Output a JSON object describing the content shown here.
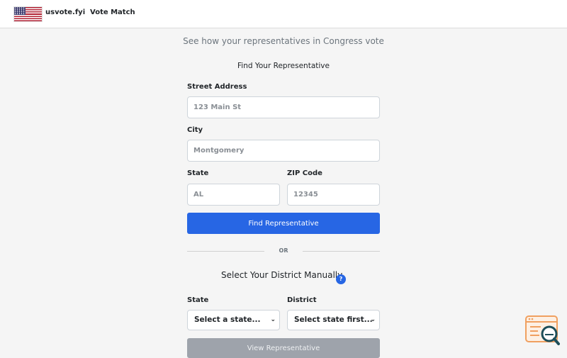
{
  "header": {
    "brand": "usvote.fyi",
    "nav_link": "Vote Match"
  },
  "subtitle": "See how your representatives in Congress vote",
  "address_form": {
    "title": "Find Your Representative",
    "street_label": "Street Address",
    "street_placeholder": "123 Main St",
    "city_label": "City",
    "city_placeholder": "Montgomery",
    "state_label": "State",
    "state_placeholder": "AL",
    "zip_label": "ZIP Code",
    "zip_placeholder": "12345",
    "submit_label": "Find Representative"
  },
  "divider_text": "OR",
  "manual_form": {
    "title": "Select Your District Manually",
    "help_icon_text": "?",
    "state_label": "State",
    "state_select_value": "Select a state...",
    "district_label": "District",
    "district_select_value": "Select state first...",
    "submit_label": "View Representative"
  },
  "colors": {
    "primary": "#2766e4",
    "disabled": "#9ea3ab",
    "widget": "#f0a060"
  },
  "icons": {
    "flag": "us-flag-icon",
    "help": "help-icon",
    "chevron": "chevron-down-icon",
    "widget": "search-widget-icon"
  }
}
